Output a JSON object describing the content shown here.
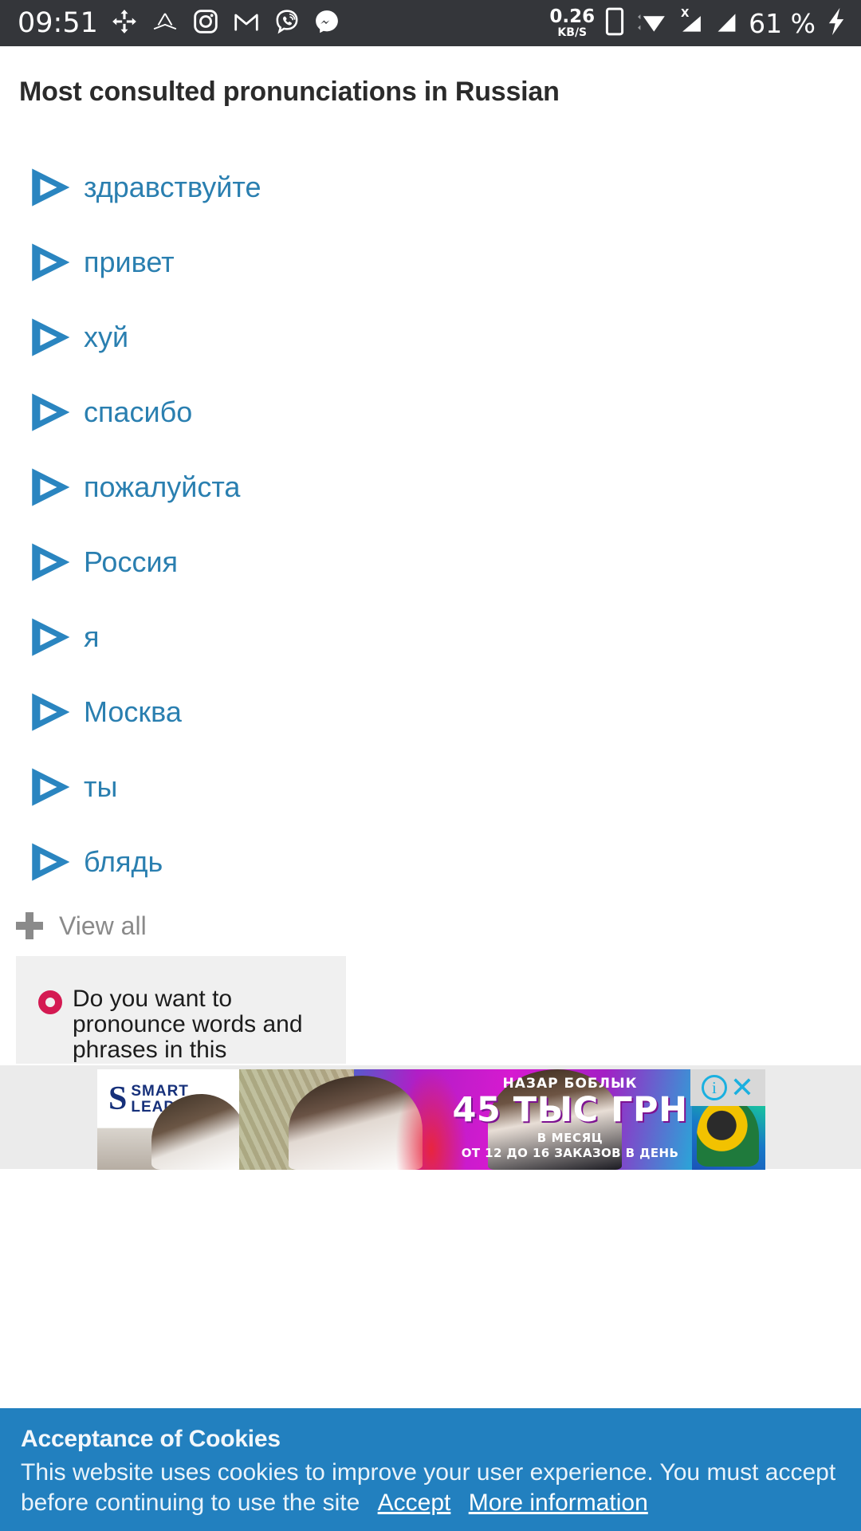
{
  "statusbar": {
    "time": "09:51",
    "left_icons": [
      {
        "name": "move-arrows-icon"
      },
      {
        "name": "clothes-hanger-icon"
      },
      {
        "name": "instagram-icon"
      },
      {
        "name": "gmail-icon"
      },
      {
        "name": "viber-icon"
      },
      {
        "name": "messenger-icon"
      }
    ],
    "network_speed_value": "0.26",
    "network_speed_unit": "KB/S",
    "right_icons": [
      {
        "name": "phone-icon"
      },
      {
        "name": "wifi-icon"
      },
      {
        "name": "signal-1-icon"
      },
      {
        "name": "signal-2-icon"
      }
    ],
    "battery_percent": "61 %",
    "charging_icon": "bolt-icon"
  },
  "page": {
    "title": "Most consulted pronunciations in Russian"
  },
  "pronunciations": [
    {
      "word": "здравствуйте"
    },
    {
      "word": "привет"
    },
    {
      "word": "хуй"
    },
    {
      "word": "спасибо"
    },
    {
      "word": "пожалуйста"
    },
    {
      "word": "Россия"
    },
    {
      "word": "я"
    },
    {
      "word": "Москва"
    },
    {
      "word": "ты"
    },
    {
      "word": "блядь"
    }
  ],
  "view_all": {
    "label": "View all"
  },
  "promo_card": {
    "text": "Do you want to pronounce words and phrases in this language"
  },
  "ad": {
    "logo_symbol": "S",
    "logo_line1": "SMART",
    "logo_line2": "LEAD",
    "headline_name": "НАЗАР БОБЛЫК",
    "headline_amount": "45 ТЫС ГРН",
    "sub1": "В МЕСЯЦ",
    "sub2": "ОТ 12 ДО 16 ЗАКАЗОВ В ДЕНЬ",
    "info_glyph": "i",
    "close_glyph": "✕"
  },
  "cookie_banner": {
    "title": "Acceptance of Cookies",
    "body": "This website uses cookies to improve your user experience. You must accept before continuing to use the site",
    "accept_label": "Accept",
    "more_info_label": "More information"
  },
  "colors": {
    "accent_blue": "#2a85c0",
    "word_blue": "#2a7fb0",
    "banner_blue": "#2280bf",
    "card_gray": "#f0f0f0",
    "ring_crimson": "#d41a52",
    "statusbar_bg": "#34363a"
  }
}
